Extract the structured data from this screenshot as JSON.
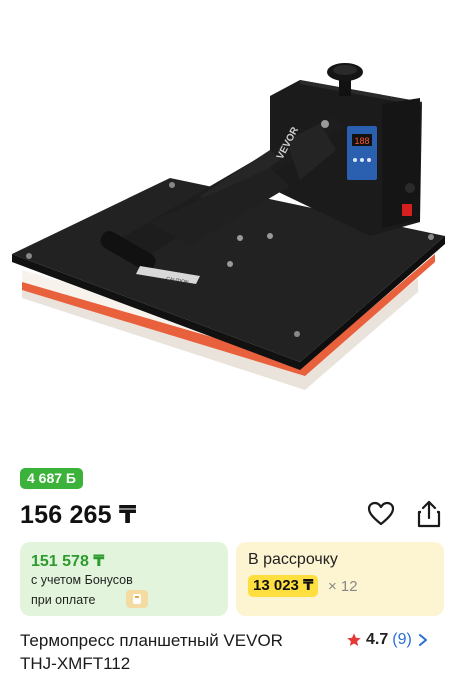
{
  "product": {
    "title_line1": "Термопресс планшетный VEVOR",
    "title_line2": "THJ-XMFT112",
    "brand_on_device": "VEVOR",
    "display_readout": "188"
  },
  "pricing": {
    "bonus_badge": "4 687 Б",
    "price": "156 265 ₸",
    "bonus_price": "151 578 ₸",
    "bonus_note_line1": "с учетом Бонусов",
    "bonus_note_line2": "при оплате",
    "installment_title": "В рассрочку",
    "installment_amount": "13 023 ₸",
    "installment_multiplier": "× 12"
  },
  "rating": {
    "score": "4.7",
    "count": "(9)"
  },
  "icons": [
    "heart-icon",
    "share-icon",
    "star-icon",
    "chevron-right-icon",
    "pay-wallet-icon"
  ],
  "colors": {
    "badge_green": "#3bb33b",
    "bonus_bg": "#e2f5dc",
    "bonus_text": "#2e9b2e",
    "installment_bg": "#fdf5d1",
    "installment_highlight": "#ffdf3f",
    "link_blue": "#2b6fd6",
    "star_red": "#e53935"
  }
}
